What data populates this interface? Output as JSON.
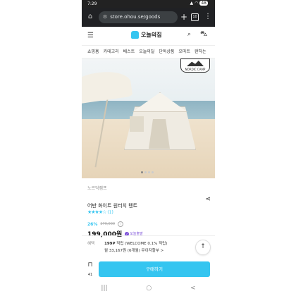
{
  "status": {
    "time": "7:29",
    "battery": "48"
  },
  "browser": {
    "url": "store.ohou.se/goods",
    "tab_count": "10",
    "home_icon": "home-icon",
    "menu_icon": "more-vert-icon"
  },
  "site": {
    "logo_text": "오늘의집",
    "accent": "#35c5f0"
  },
  "categories": [
    "쇼핑홈",
    "카테고리",
    "베스트",
    "오늘의딜",
    "단독상품",
    "오마트",
    "완하는"
  ],
  "product": {
    "brand_badge": "NORDIC CAMP",
    "brand": "노르딕캠프",
    "title": "어반 화이트 원터치 텐트",
    "stars": "★★★★☆",
    "review_count": "(1)",
    "discount": "26%",
    "original_price": "270,000",
    "sale_price": "199,000원",
    "delivery_badge": "오늘출발",
    "rating_value": 4
  },
  "benefit": {
    "label": "혜택",
    "points": "199P",
    "points_text": " 적립 (WELCOME 0.1% 적립)",
    "installment": "월 33,167원 (6개월) 무이자할부 >"
  },
  "bottom": {
    "bookmark_count": "41",
    "buy_label": "구매하기"
  },
  "android_nav": {
    "recents": "|||",
    "home": "○",
    "back": "<"
  }
}
